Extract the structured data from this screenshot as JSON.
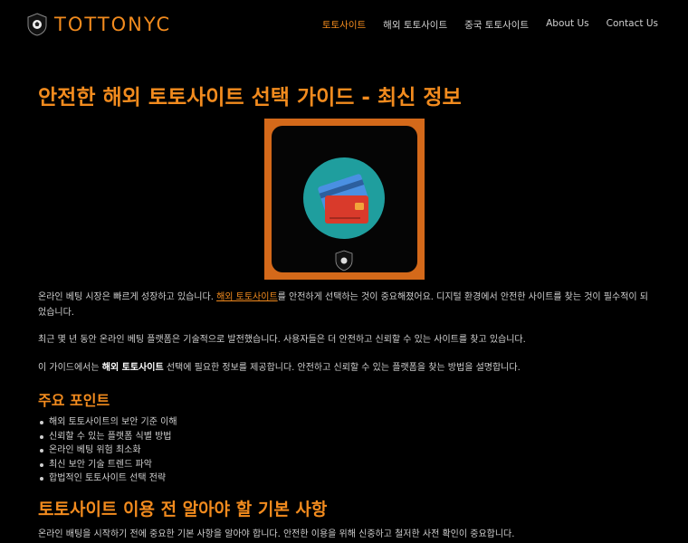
{
  "brand": {
    "name": "TOTTONYC",
    "accent": "#f28b1e"
  },
  "nav": {
    "items": [
      {
        "label": "토토사이트",
        "active": true
      },
      {
        "label": "해외 토토사이트",
        "active": false
      },
      {
        "label": "중국 토토사이트",
        "active": false
      },
      {
        "label": "About Us",
        "active": false
      },
      {
        "label": "Contact Us",
        "active": false
      }
    ]
  },
  "article": {
    "title": "안전한 해외 토토사이트 선택 가이드 - 최신 정보",
    "hero_image": {
      "icon": "credit-card-icon",
      "badge_text": "TOTTONYC",
      "frame_color": "#d4691a",
      "circle_color": "#1f9e9e"
    },
    "p1": {
      "before": "온라인 베팅 시장은 빠르게 성장하고 있습니다. ",
      "link": "해외 토토사이트",
      "after": "를 안전하게 선택하는 것이 중요해졌어요. 디지털 환경에서 안전한 사이트를 찾는 것이 필수적이 되었습니다."
    },
    "p2": "최근 몇 년 동안 온라인 베팅 플랫폼은 기술적으로 발전했습니다. 사용자들은 더 안전하고 신뢰할 수 있는 사이트를 찾고 있습니다.",
    "p3": {
      "before": "이 가이드에서는 ",
      "strong": "해외 토토사이트",
      "after": " 선택에 필요한 정보를 제공합니다. 안전하고 신뢰할 수 있는 플랫폼을 찾는 방법을 설명합니다."
    },
    "h_points": "주요 포인트",
    "points": [
      "해외 토토사이트의 보안 기준 이해",
      "신뢰할 수 있는 플랫폼 식별 방법",
      "온라인 베팅 위험 최소화",
      "최신 보안 기술 트렌드 파악",
      "합법적인 토토사이트 선택 전략"
    ],
    "h_basics": "토토사이트 이용 전 알아야 할 기본 사항",
    "p4": "온라인 배팅을 시작하기 전에 중요한 기본 사항을 알아야 합니다. 안전한 이용을 위해 신중하고 철저한 사전 확인이 중요합니다."
  }
}
